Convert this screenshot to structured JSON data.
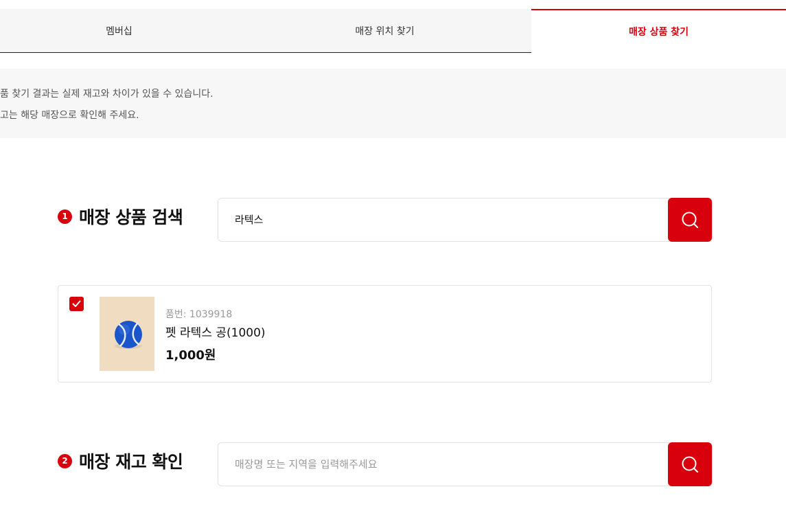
{
  "tabs": [
    {
      "label": "멤버십"
    },
    {
      "label": "매장 위치 찾기"
    },
    {
      "label": "매장 상품 찾기"
    }
  ],
  "notice": {
    "line1": "품 찾기 결과는 실제 재고와 차이가 있을 수 있습니다.",
    "line2": "고는 해당 매장으로 확인해 주세요."
  },
  "section1": {
    "number": "1",
    "title": "매장 상품 검색",
    "input_value": "라텍스"
  },
  "product": {
    "code": "품번: 1039918",
    "name": "펫 라텍스 공(1000)",
    "price": "1,000원",
    "checked": true
  },
  "section2": {
    "number": "2",
    "title": "매장 재고 확인",
    "placeholder": "매장명 또는 지역을 입력해주세요"
  },
  "colors": {
    "accent": "#d9000d",
    "notice_bg": "#f7f7f7",
    "tab_bg": "#f6f6f6"
  }
}
